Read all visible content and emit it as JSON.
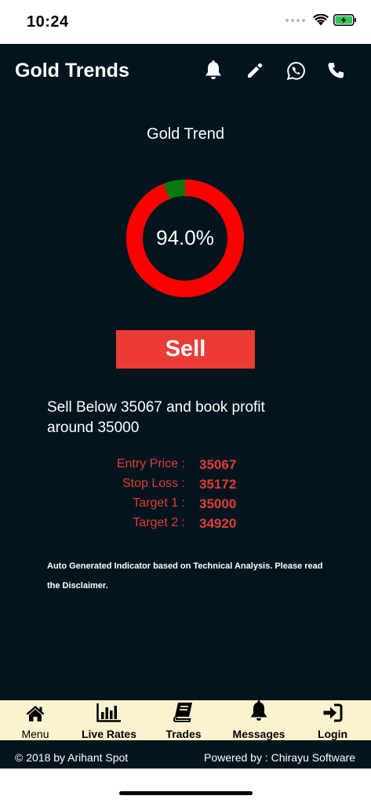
{
  "status_bar": {
    "time": "10:24",
    "icons": [
      "signal-dots-icon",
      "wifi-icon",
      "battery-charging-icon"
    ]
  },
  "header": {
    "title": "Gold Trends",
    "actions": [
      "bell-icon",
      "pencil-icon",
      "whatsapp-icon",
      "phone-icon"
    ]
  },
  "trend": {
    "title": "Gold Trend",
    "percent_text": "94.0%",
    "percent": 94.0,
    "colors": {
      "main": "#ff0000",
      "rest": "#0a7a10"
    }
  },
  "signal": {
    "action_label": "Sell",
    "button_color": "#ec3b35",
    "advice": "Sell Below 35067 and book profit around 35000"
  },
  "levels": [
    {
      "label": "Entry Price :",
      "value": "35067"
    },
    {
      "label": "Stop Loss :",
      "value": "35172"
    },
    {
      "label": "Target 1 :",
      "value": "35000"
    },
    {
      "label": "Target 2 :",
      "value": "34920"
    }
  ],
  "disclaimer": "Auto Generated Indicator based on Technical Analysis. Please read the Disclaimer.",
  "nav": [
    {
      "label": "Menu",
      "icon": "home-icon"
    },
    {
      "label": "Live Rates",
      "icon": "bar-chart-icon"
    },
    {
      "label": "Trades",
      "icon": "book-icon"
    },
    {
      "label": "Messages",
      "icon": "bell-icon"
    },
    {
      "label": "Login",
      "icon": "login-icon"
    }
  ],
  "footer": {
    "copyright": "© 2018 by Arihant Spot",
    "powered_by": "Powered by : Chirayu Software"
  }
}
